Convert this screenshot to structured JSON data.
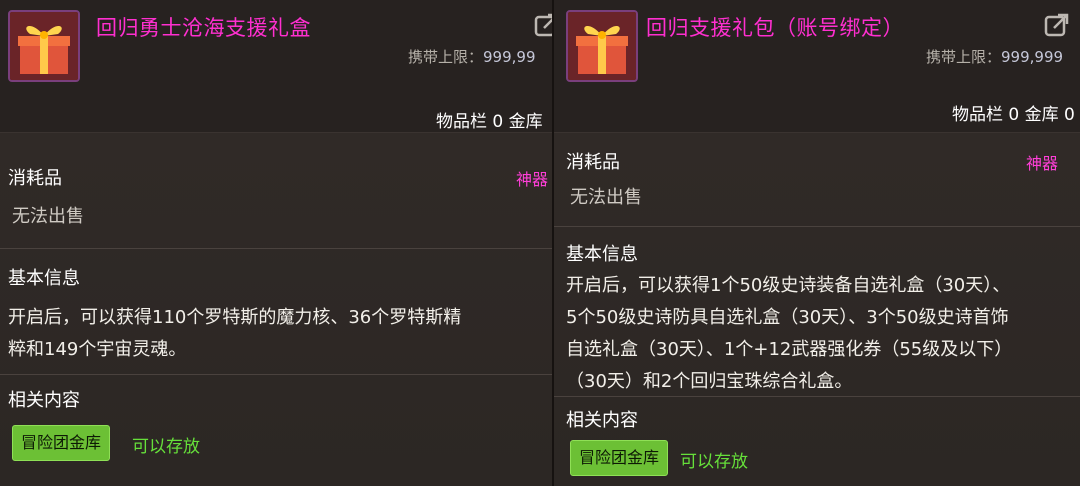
{
  "left": {
    "title": "回归勇士沧海支援礼盒",
    "carry_label": "携带上限：",
    "carry_value": "999,99",
    "storage_text": "物品栏 0 金库",
    "category": "消耗品",
    "rarity": "神器",
    "sell_status": "无法出售",
    "basic_info_heading": "基本信息",
    "description_lines": [
      "开启后，可以获得110个罗特斯的魔力核、36个罗特斯精",
      "粹和149个宇宙灵魂。"
    ],
    "related_heading": "相关内容",
    "tag_label": "冒险团金库",
    "tag_status": "可以存放"
  },
  "right": {
    "title": "回归支援礼包（账号绑定）",
    "carry_label": "携带上限：",
    "carry_value": "999,999",
    "storage_text": "物品栏 0 金库 0",
    "category": "消耗品",
    "rarity": "神器",
    "sell_status": "无法出售",
    "basic_info_heading": "基本信息",
    "description_lines": [
      "开启后，可以获得1个50级史诗装备自选礼盒（30天）、",
      "5个50级史诗防具自选礼盒（30天）、3个50级史诗首饰",
      "自选礼盒（30天）、1个+12武器强化券（55级及以下）",
      "（30天）和2个回归宝珠综合礼盒。"
    ],
    "related_heading": "相关内容",
    "tag_label": "冒险团金库",
    "tag_status": "可以存放"
  },
  "icons": {
    "item": "gift-box-icon",
    "export": "export-link-icon"
  },
  "colors": {
    "title": "#ff2fd0",
    "rarity": "#ff3fd8",
    "tag_bg": "#6cc035",
    "ok_text": "#66e03a"
  }
}
